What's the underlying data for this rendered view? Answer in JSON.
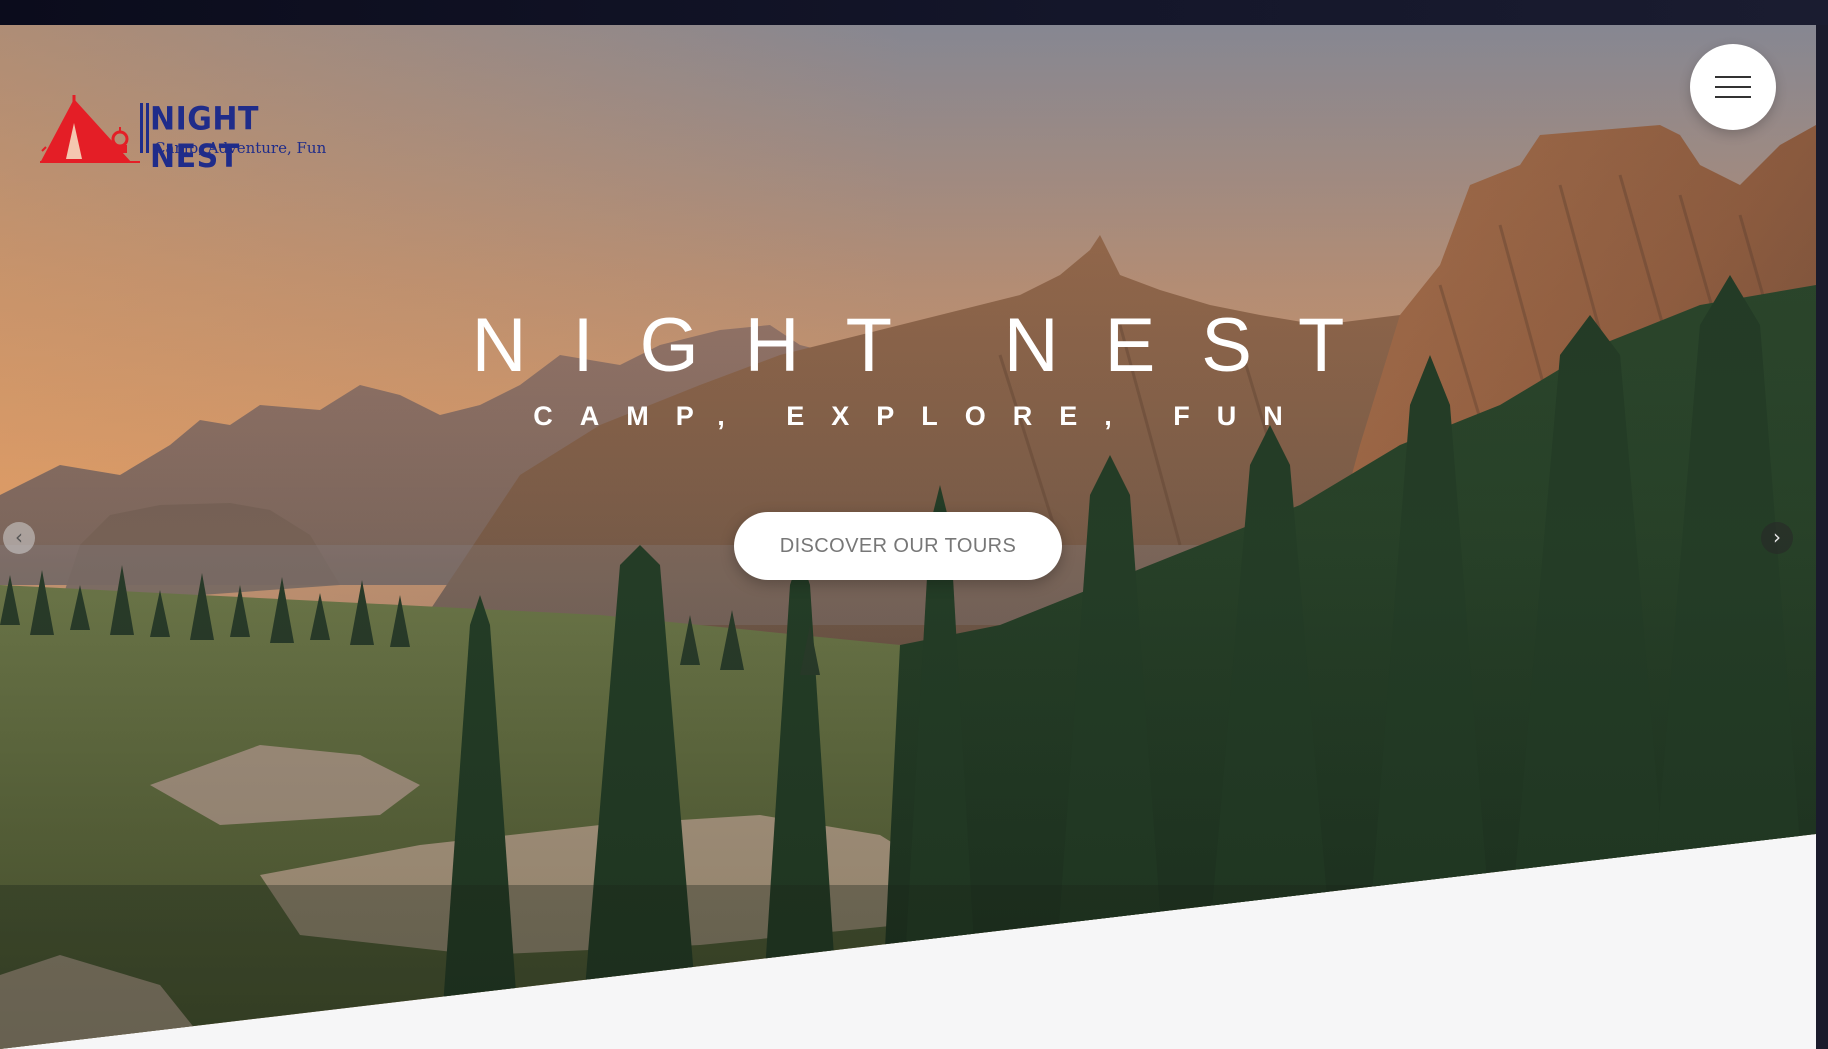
{
  "brand": {
    "name": "NIGHT NEST",
    "tagline": "Camp, Adventure, Fun",
    "logo_icon": "tent-lantern-icon",
    "colors": {
      "logo_red": "#e41e26",
      "logo_blue": "#1f2c8a"
    }
  },
  "header": {
    "menu_icon": "hamburger-menu-icon"
  },
  "hero": {
    "title": "NIGHT NEST",
    "subtitle": "CAMP, EXPLORE, FUN",
    "cta_label": "DISCOVER OUR TOURS",
    "background": "mountain-forest-sunset-image",
    "prev_label": "‹",
    "next_label": "›"
  }
}
